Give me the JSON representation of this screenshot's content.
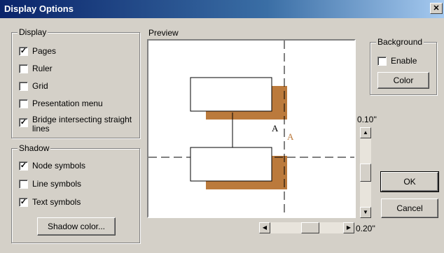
{
  "window": {
    "title": "Display Options",
    "close_symbol": "✕"
  },
  "display": {
    "legend": "Display",
    "items": [
      {
        "label": "Pages",
        "checked": true
      },
      {
        "label": "Ruler",
        "checked": false
      },
      {
        "label": "Grid",
        "checked": false
      },
      {
        "label": "Presentation menu",
        "checked": false
      },
      {
        "label": "Bridge intersecting straight lines",
        "checked": true
      }
    ]
  },
  "shadow": {
    "legend": "Shadow",
    "items": [
      {
        "label": "Node symbols",
        "checked": true
      },
      {
        "label": "Line symbols",
        "checked": false
      },
      {
        "label": "Text symbols",
        "checked": true
      }
    ],
    "color_button": "Shadow color..."
  },
  "preview": {
    "label": "Preview",
    "text_sample": "A",
    "shadow_text_sample": "A",
    "shadow_color": "#bb7a3c"
  },
  "background": {
    "legend": "Background",
    "enable_label": "Enable",
    "enable_checked": false,
    "color_button": "Color"
  },
  "vertical_offset": {
    "value_label": "0.10''",
    "value": 0.1
  },
  "horizontal_offset": {
    "value_label": "0.20''",
    "value": 0.2
  },
  "buttons": {
    "ok": "OK",
    "cancel": "Cancel"
  },
  "icons": {
    "scroll_up": "▲",
    "scroll_down": "▼",
    "scroll_left": "◀",
    "scroll_right": "▶"
  }
}
